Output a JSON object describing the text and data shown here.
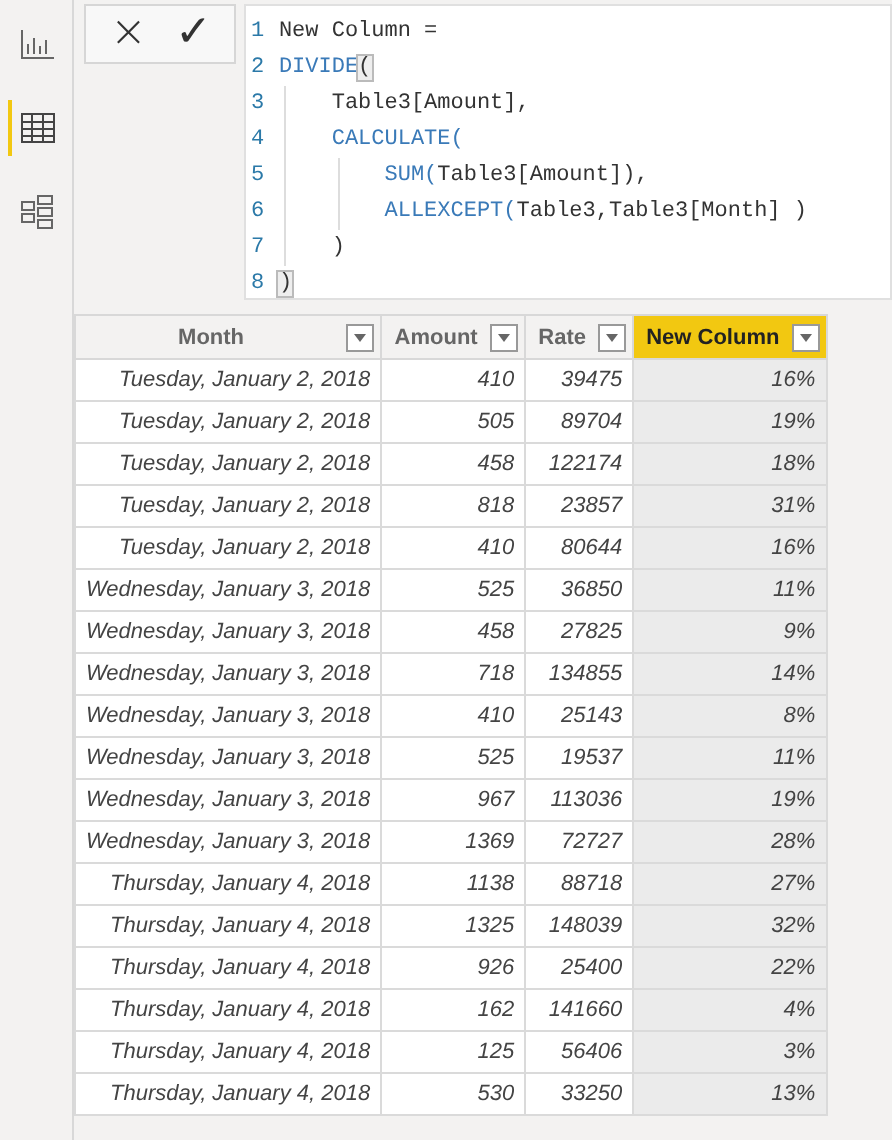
{
  "sidebar": {
    "items": [
      {
        "kind": "report",
        "selected": false
      },
      {
        "kind": "data",
        "selected": true
      },
      {
        "kind": "model",
        "selected": false
      }
    ]
  },
  "formula_bar": {
    "buttons": [
      "×",
      "✓"
    ],
    "lines": [
      {
        "number": "1",
        "tokens": [
          {
            "kind": "plain",
            "text": "New Column ="
          }
        ]
      },
      {
        "number": "2",
        "tokens": [
          {
            "kind": "function",
            "text": "DIVIDE"
          },
          {
            "kind": "bracket",
            "text": "("
          }
        ]
      },
      {
        "number": "3",
        "tokens": [
          {
            "kind": "plain",
            "text": "    Table3[Amount],"
          }
        ]
      },
      {
        "number": "4",
        "tokens": [
          {
            "kind": "function",
            "text": "    CALCULATE("
          }
        ]
      },
      {
        "number": "5",
        "tokens": [
          {
            "kind": "function",
            "text": "        SUM("
          },
          {
            "kind": "plain",
            "text": "Table3[Amount]),"
          }
        ]
      },
      {
        "number": "6",
        "tokens": [
          {
            "kind": "function",
            "text": "        ALLEXCEPT("
          },
          {
            "kind": "plain",
            "text": "Table3,Table3[Month] )"
          }
        ]
      },
      {
        "number": "7",
        "tokens": [
          {
            "kind": "plain",
            "text": "    )"
          }
        ]
      },
      {
        "number": "8",
        "tokens": [
          {
            "kind": "bracket",
            "text": ")"
          }
        ]
      }
    ]
  },
  "table": {
    "columns": [
      {
        "label": "Month",
        "selected": false
      },
      {
        "label": "Amount",
        "selected": false
      },
      {
        "label": "Rate",
        "selected": false
      },
      {
        "label": "New Column",
        "selected": true
      }
    ],
    "rows": [
      [
        "Tuesday, January 2, 2018",
        "410",
        "39475",
        "16%"
      ],
      [
        "Tuesday, January 2, 2018",
        "505",
        "89704",
        "19%"
      ],
      [
        "Tuesday, January 2, 2018",
        "458",
        "122174",
        "18%"
      ],
      [
        "Tuesday, January 2, 2018",
        "818",
        "23857",
        "31%"
      ],
      [
        "Tuesday, January 2, 2018",
        "410",
        "80644",
        "16%"
      ],
      [
        "Wednesday, January 3, 2018",
        "525",
        "36850",
        "11%"
      ],
      [
        "Wednesday, January 3, 2018",
        "458",
        "27825",
        "9%"
      ],
      [
        "Wednesday, January 3, 2018",
        "718",
        "134855",
        "14%"
      ],
      [
        "Wednesday, January 3, 2018",
        "410",
        "25143",
        "8%"
      ],
      [
        "Wednesday, January 3, 2018",
        "525",
        "19537",
        "11%"
      ],
      [
        "Wednesday, January 3, 2018",
        "967",
        "113036",
        "19%"
      ],
      [
        "Wednesday, January 3, 2018",
        "1369",
        "72727",
        "28%"
      ],
      [
        "Thursday, January 4, 2018",
        "1138",
        "88718",
        "27%"
      ],
      [
        "Thursday, January 4, 2018",
        "1325",
        "148039",
        "32%"
      ],
      [
        "Thursday, January 4, 2018",
        "926",
        "25400",
        "22%"
      ],
      [
        "Thursday, January 4, 2018",
        "162",
        "141660",
        "4%"
      ],
      [
        "Thursday, January 4, 2018",
        "125",
        "56406",
        "3%"
      ],
      [
        "Thursday, January 4, 2018",
        "530",
        "33250",
        "13%"
      ]
    ]
  }
}
